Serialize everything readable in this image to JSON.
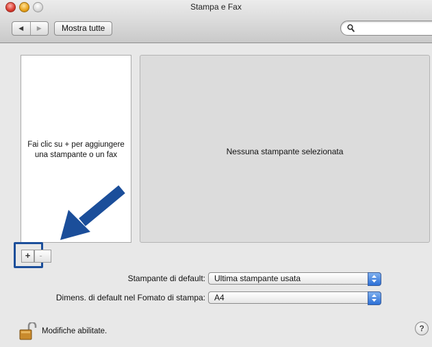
{
  "window": {
    "title": "Stampa e Fax"
  },
  "toolbar": {
    "back_label": "◀",
    "forward_label": "▶",
    "show_all_label": "Mostra tutte",
    "search": {
      "value": "",
      "placeholder": ""
    }
  },
  "printers": {
    "items": [],
    "empty_hint": "Fai clic su + per aggiungere una stampante o un fax",
    "add_label": "+",
    "remove_label": "-"
  },
  "detail": {
    "empty_message": "Nessuna stampante selezionata"
  },
  "settings": {
    "default_printer": {
      "label": "Stampante di default:",
      "value": "Ultima stampante usata"
    },
    "default_paper": {
      "label": "Dimens. di default nel Fomato di stampa:",
      "value": "A4"
    }
  },
  "footer": {
    "lock_label": "Modifiche abilitate.",
    "help_label": "?"
  },
  "colors": {
    "annotation_blue": "#1b4e9a",
    "popup_accent": "#2c6fd6"
  },
  "icons": [
    "close-window-icon",
    "minimize-window-icon",
    "zoom-window-icon",
    "search-icon",
    "arrow-annotation-icon",
    "popup-stepper-icon",
    "lock-open-icon",
    "help-icon"
  ]
}
